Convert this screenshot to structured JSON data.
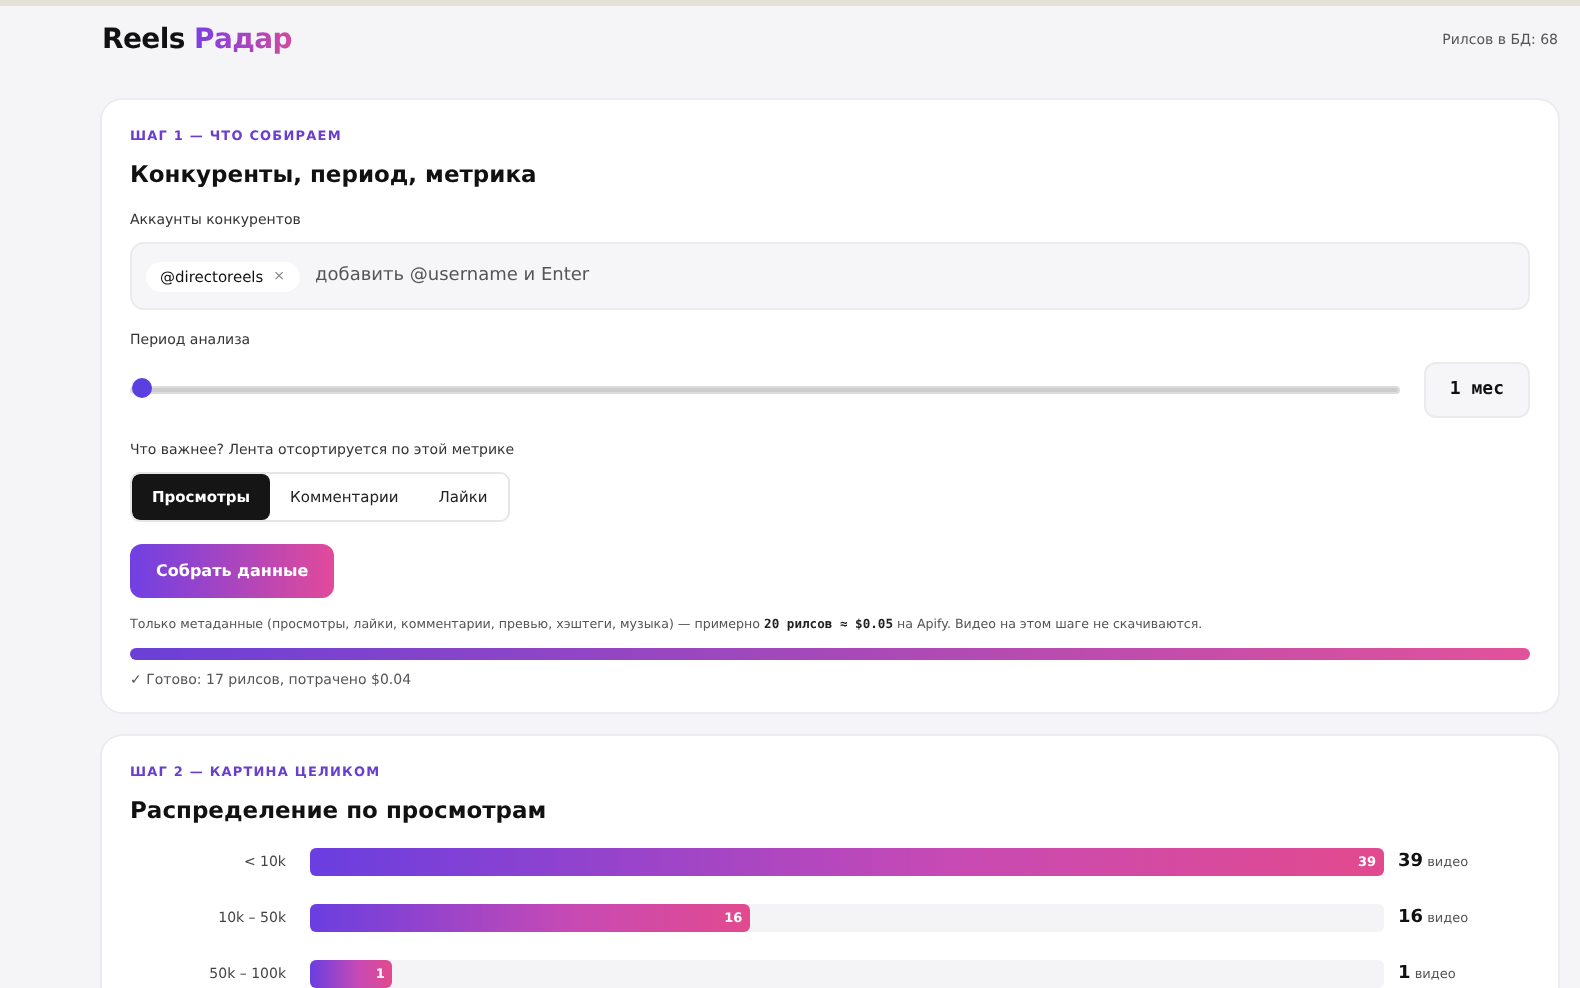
{
  "header": {
    "logo_main": "Reels",
    "logo_accent": "Радар",
    "db_count": "Рилсов в БД: 68"
  },
  "step1": {
    "eyebrow": "ШАГ 1 — ЧТО СОБИРАЕМ",
    "title": "Конкуренты, период, метрика",
    "accounts_label": "Аккаунты конкурентов",
    "accounts": [
      {
        "handle": "@directoreels",
        "remove": "×"
      }
    ],
    "accounts_placeholder": "добавить @username и Enter",
    "period_label": "Период анализа",
    "period": {
      "level": 0,
      "reading": "1 мес"
    },
    "metric_label": "Что важнее? Лента отсортируется по этой метрике",
    "metrics": [
      {
        "label": "Просмотры",
        "selected": true
      },
      {
        "label": "Комментарии",
        "selected": false
      },
      {
        "label": "Лайки",
        "selected": false
      }
    ],
    "collect_button": "Собрать данные",
    "note": "Только метаданные (просмотры, лайки, комментарии, превью, хэштеги, музыка) — примерно **20 рилсов ≈ $0.05** на Apify. Видео на этом шаге не скачиваются.",
    "progress": {
      "level": 1
    },
    "status": "✓ Готово: 17 рилсов, потрачено $0.04"
  },
  "step2": {
    "eyebrow": "ШАГ 2 — КАРТИНА ЦЕЛИКОМ",
    "title": "Распределение по просмотрам",
    "bins": [
      {
        "label": "< 10k",
        "level": 1,
        "bar_value": "39",
        "count": "39",
        "unit": "видео"
      },
      {
        "label": "10k – 50k",
        "level": 0.41,
        "bar_value": "16",
        "count": "16",
        "unit": "видео"
      },
      {
        "label": "50k – 100k",
        "level": 0.077,
        "bar_value": "1",
        "count": "1",
        "unit": "видео"
      }
    ]
  }
}
